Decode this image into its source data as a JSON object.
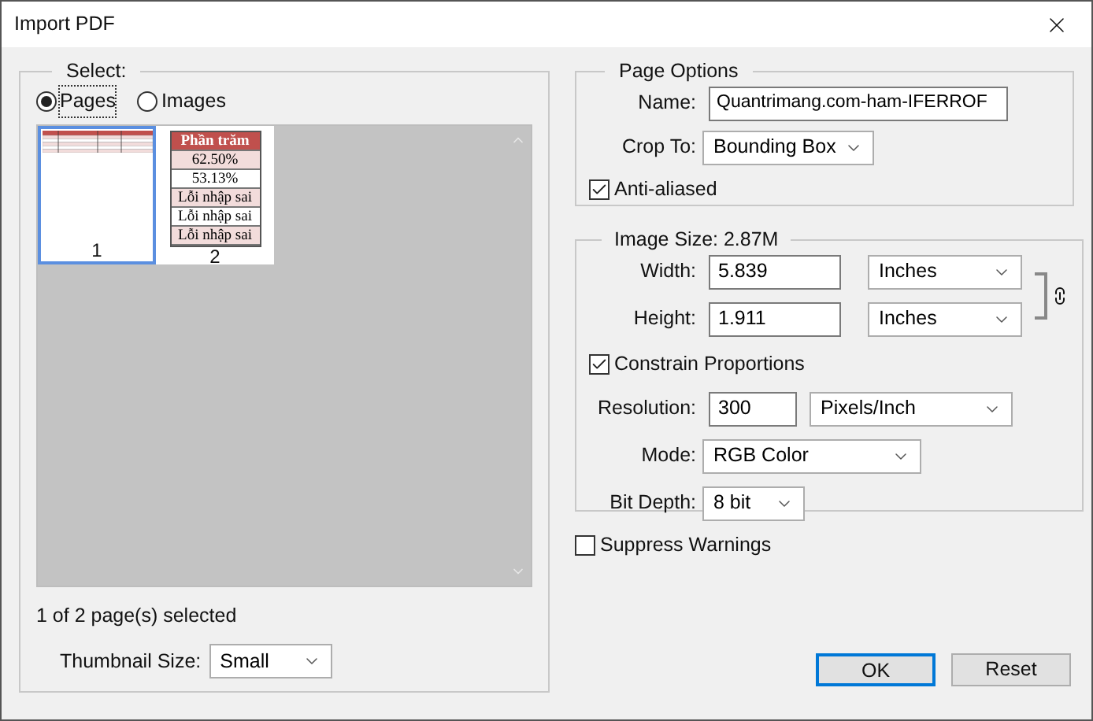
{
  "window": {
    "title": "Import PDF"
  },
  "select": {
    "legend": "Select:",
    "options": [
      {
        "label": "Pages",
        "selected": true
      },
      {
        "label": "Images",
        "selected": false
      }
    ],
    "thumbnails": [
      {
        "label": "1",
        "selected": true,
        "kind": "table"
      },
      {
        "label": "2",
        "selected": false,
        "kind": "cells",
        "cells": [
          {
            "text": "Phần trăm",
            "kind": "header"
          },
          {
            "text": "62.50%",
            "kind": "shaded"
          },
          {
            "text": "53.13%",
            "kind": "plain"
          },
          {
            "text": "Lỗi nhập sai",
            "kind": "shaded"
          },
          {
            "text": "Lỗi nhập sai",
            "kind": "plain"
          },
          {
            "text": "Lỗi nhập sai",
            "kind": "shaded"
          }
        ]
      }
    ],
    "status": "1 of 2 page(s) selected",
    "thumbnail_size": {
      "label": "Thumbnail Size:",
      "value": "Small"
    }
  },
  "page_options": {
    "legend": "Page Options",
    "name": {
      "label": "Name:",
      "value": "Quantrimang.com-ham-IFERROF"
    },
    "crop_to": {
      "label": "Crop To:",
      "value": "Bounding Box"
    },
    "anti_aliased": {
      "label": "Anti-aliased",
      "checked": true
    }
  },
  "image_size": {
    "legend": "Image Size: 2.87M",
    "width": {
      "label": "Width:",
      "value": "5.839",
      "unit": "Inches"
    },
    "height": {
      "label": "Height:",
      "value": "1.911",
      "unit": "Inches"
    },
    "linked": true,
    "constrain": {
      "label": "Constrain Proportions",
      "checked": true
    },
    "resolution": {
      "label": "Resolution:",
      "value": "300",
      "unit": "Pixels/Inch"
    },
    "mode": {
      "label": "Mode:",
      "value": "RGB Color"
    },
    "bit_depth": {
      "label": "Bit Depth:",
      "value": "8 bit"
    }
  },
  "suppress_warnings": {
    "label": "Suppress Warnings",
    "checked": false
  },
  "buttons": [
    {
      "label": "OK",
      "default": true
    },
    {
      "label": "Reset",
      "default": false
    }
  ]
}
